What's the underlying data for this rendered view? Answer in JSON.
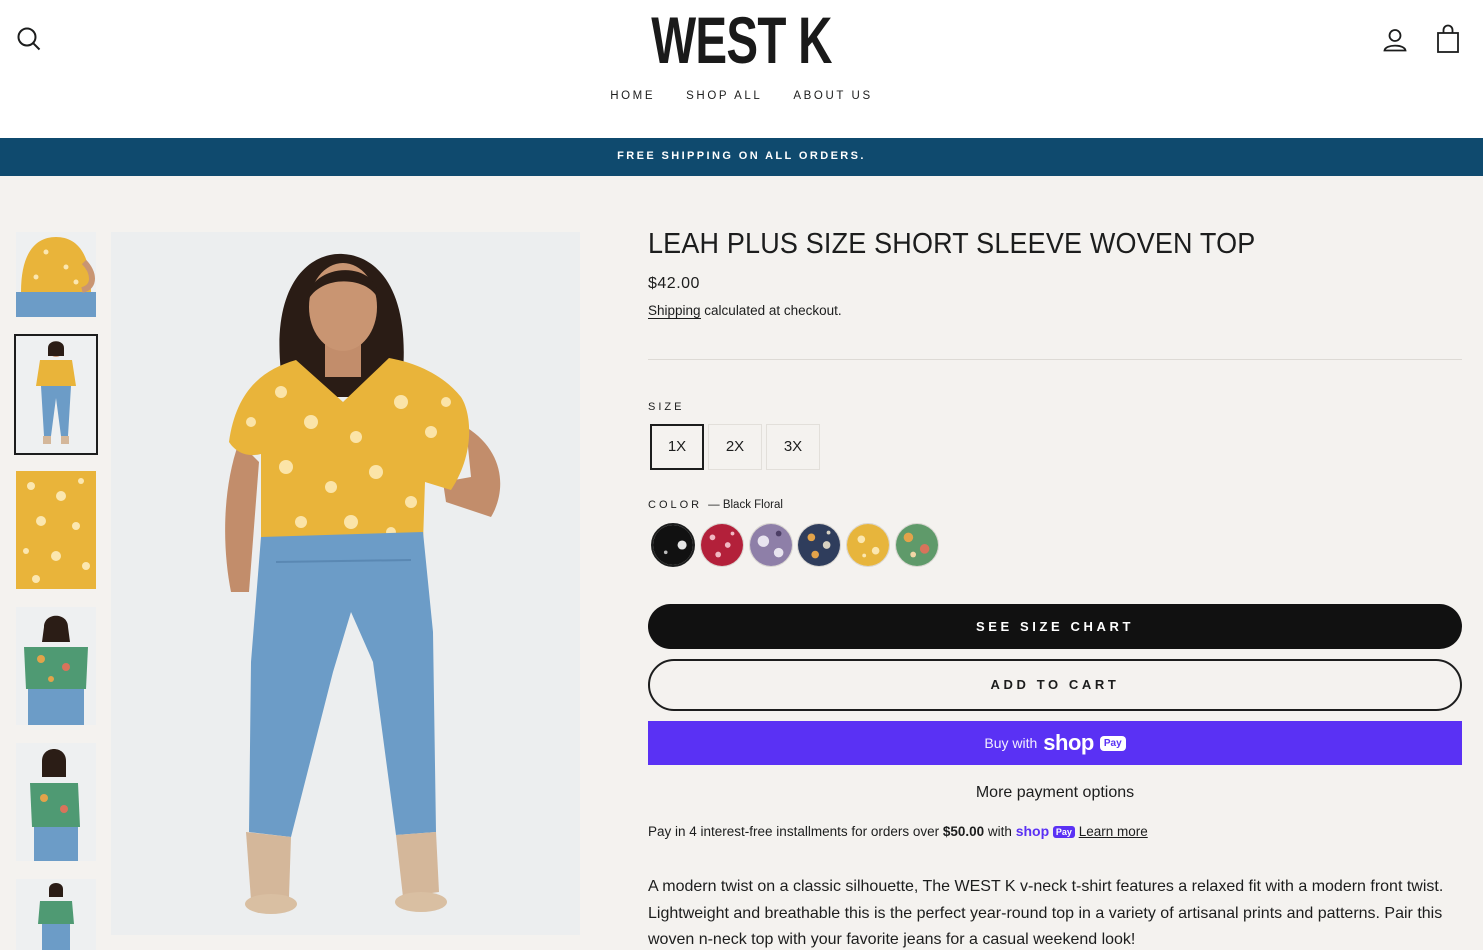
{
  "header": {
    "logo": "WEST K",
    "nav": [
      {
        "label": "HOME"
      },
      {
        "label": "SHOP ALL"
      },
      {
        "label": "ABOUT US"
      }
    ],
    "icons": [
      "search-icon",
      "account-icon",
      "cart-icon"
    ]
  },
  "announcement": "FREE SHIPPING ON ALL ORDERS.",
  "product": {
    "title": "LEAH PLUS SIZE SHORT SLEEVE WOVEN TOP",
    "price": "$42.00",
    "shipping_link": "Shipping",
    "shipping_rest": " calculated at checkout.",
    "size_label": "SIZE",
    "sizes": [
      "1X",
      "2X",
      "3X"
    ],
    "selected_size": "1X",
    "color_label": "COLOR",
    "color_selected": "— Black Floral",
    "swatches": [
      {
        "name": "Black Floral",
        "color": "#111111"
      },
      {
        "name": "Red Floral",
        "color": "#b3203a"
      },
      {
        "name": "Lavender Floral",
        "color": "#8e7fa8"
      },
      {
        "name": "Navy Floral",
        "color": "#2f3d5c"
      },
      {
        "name": "Mustard Floral",
        "color": "#e7b53c"
      },
      {
        "name": "Green Floral",
        "color": "#5f9a6a"
      }
    ],
    "size_chart_button": "SEE SIZE CHART",
    "add_to_cart_button": "ADD TO CART",
    "shoppay": {
      "buy_with": "Buy with",
      "shop": "shop",
      "pay": "Pay"
    },
    "more_payment": "More payment options",
    "installments": {
      "text_before": "Pay in 4 interest-free installments for orders over ",
      "amount": "$50.00",
      "text_with": " with ",
      "shop": "shop",
      "pay": "Pay",
      "learn_more": "Learn more"
    },
    "description": "A modern twist on a classic silhouette, The WEST K v-neck t-shirt features a relaxed fit with a modern front twist. Lightweight and breathable this is the perfect year-round top in a variety of artisanal prints and patterns. Pair this woven n-neck top with your favorite jeans for a casual weekend look!"
  },
  "colors": {
    "announcement_bg": "#0f4a6e",
    "shoppay": "#5a31f4",
    "page_bg": "#f4f2ef",
    "top_yellow": "#e9b43a",
    "top_green": "#4f9a73",
    "denim": "#6c9cc7"
  }
}
